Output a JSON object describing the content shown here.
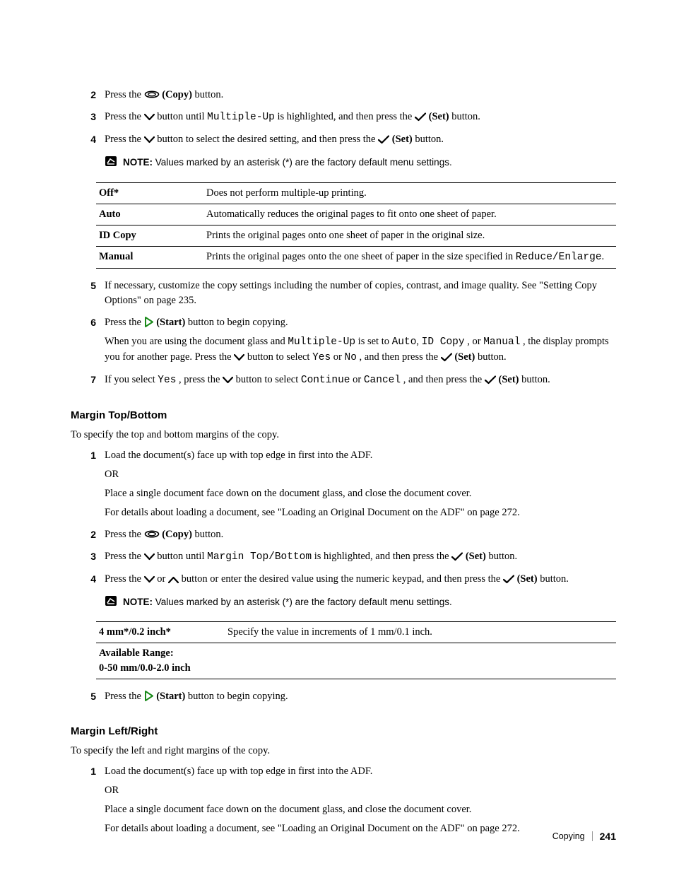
{
  "steps_top": {
    "s2": {
      "pre": "Press the ",
      "btn": "(Copy)",
      "post": " button."
    },
    "s3": {
      "pre": "Press the ",
      "mid1": " button until ",
      "code": "Multiple-Up",
      "mid2": " is highlighted, and then press the ",
      "btn": "(Set)",
      "post": " button."
    },
    "s4": {
      "pre": "Press the ",
      "mid1": " button to select the desired setting, and then press the ",
      "btn": "(Set)",
      "post": " button."
    }
  },
  "note1": {
    "label": "NOTE:",
    "text": " Values marked by an asterisk (*) are the factory default menu settings."
  },
  "table1": {
    "r1": {
      "k": "Off*",
      "v": "Does not perform multiple-up printing."
    },
    "r2": {
      "k": "Auto",
      "v": "Automatically reduces the original pages to fit onto one sheet of paper."
    },
    "r3": {
      "k": "ID Copy",
      "v": "Prints the original pages onto one sheet of paper in the original size."
    },
    "r4": {
      "k": "Manual",
      "v_pre": "Prints the original pages onto the one sheet of paper in the size specified in ",
      "v_code": "Reduce/Enlarge",
      "v_post": "."
    }
  },
  "steps_mid": {
    "s5": "If necessary, customize the copy settings including the number of copies, contrast, and image quality. See \"Setting Copy Options\" on page 235.",
    "s6": {
      "line1_pre": "Press the ",
      "line1_btn": "(Start)",
      "line1_post": " button to begin copying.",
      "line2_a": "When you are using the document glass and ",
      "c1": "Multiple-Up",
      "line2_b": " is set to ",
      "c2": "Auto",
      "comma1": ", ",
      "c3": "ID Copy",
      "line2_c": ", or ",
      "c4": "Manual",
      "line2_d": ", the display prompts you for another page. Press the ",
      "line2_e": " button to select ",
      "c5": "Yes",
      "or": " or ",
      "c6": "No",
      "line2_f": ", and then press the ",
      "btn": "(Set)",
      "line2_g": " button."
    },
    "s7": {
      "a": "If you select ",
      "c1": "Yes",
      "b": ", press the ",
      "c": " button to select ",
      "c2": "Continue",
      "or": " or ",
      "c3": "Cancel",
      "d": ", and then press the ",
      "btn": "(Set)",
      "e": " button."
    }
  },
  "section_mtb": {
    "heading": "Margin Top/Bottom",
    "lead": "To specify the top and bottom margins of the copy.",
    "s1": {
      "p1": "Load the document(s) face up with top edge in first into the ADF.",
      "p2": "OR",
      "p3": "Place a single document face down on the document glass, and close the document cover.",
      "p4": "For details about loading a document, see \"Loading an Original Document on the ADF\" on page 272."
    },
    "s2": {
      "pre": "Press the ",
      "btn": "(Copy)",
      "post": " button."
    },
    "s3": {
      "pre": "Press the ",
      "mid1": " button until ",
      "code": "Margin Top/Bottom",
      "mid2": " is highlighted, and then press the ",
      "btn": "(Set)",
      "post": " button."
    },
    "s4": {
      "pre": "Press the ",
      "or": " or ",
      "mid": " button or enter the desired value using the numeric keypad, and then press the ",
      "btn": "(Set)",
      "post": " button."
    }
  },
  "note2": {
    "label": "NOTE:",
    "text": " Values marked by an asterisk (*) are the factory default menu settings."
  },
  "table2": {
    "r1": {
      "k": "4 mm*/0.2 inch*",
      "v": "Specify the value in increments of 1 mm/0.1 inch."
    },
    "r2": {
      "k": "Available Range:\n0-50 mm/0.0-2.0 inch",
      "v": ""
    }
  },
  "s5_after_t2": {
    "pre": "Press the ",
    "btn": "(Start)",
    "post": " button to begin copying."
  },
  "section_mlr": {
    "heading": "Margin Left/Right",
    "lead": "To specify the left and right margins of the copy.",
    "s1": {
      "p1": "Load the document(s) face up with top edge in first into the ADF.",
      "p2": "OR",
      "p3": "Place a single document face down on the document glass, and close the document cover.",
      "p4": "For details about loading a document, see \"Loading an Original Document on the ADF\" on page 272."
    }
  },
  "footer": {
    "section": "Copying",
    "page": "241"
  }
}
